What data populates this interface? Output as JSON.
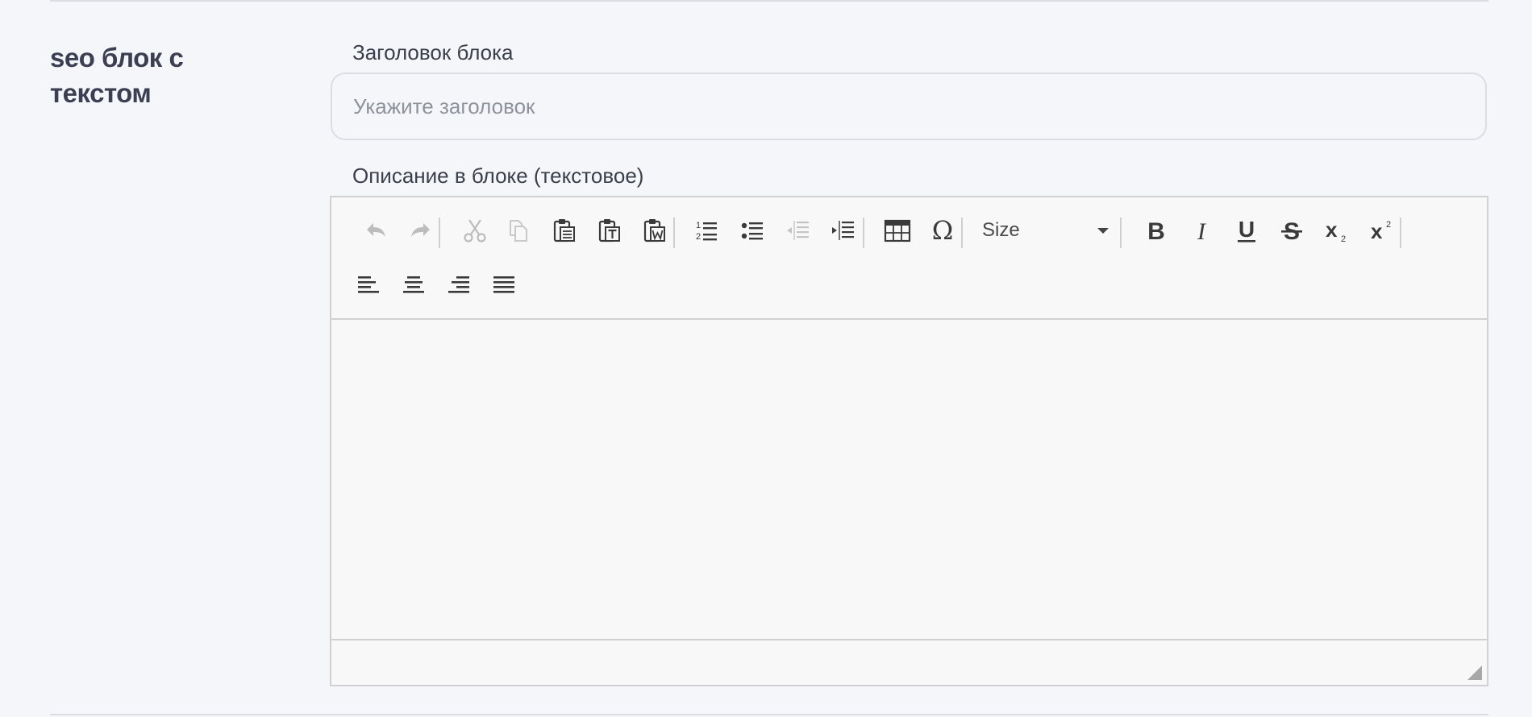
{
  "section": {
    "title": "seo блок с текстом"
  },
  "title_field": {
    "label": "Заголовок блока",
    "placeholder": "Укажите заголовок",
    "value": ""
  },
  "description_field": {
    "label": "Описание в блоке (текстовое)",
    "value": ""
  },
  "toolbar": {
    "size_label": "Size",
    "buttons": [
      "Undo",
      "Redo",
      "Cut",
      "Copy",
      "Paste",
      "Paste as plain text",
      "Paste from Word",
      "Insert/Remove Numbered List",
      "Insert/Remove Bulleted List",
      "Decrease Indent",
      "Increase Indent",
      "Table",
      "Insert Special Character",
      "Bold",
      "Italic",
      "Underline",
      "Strikethrough",
      "Subscript",
      "Superscript",
      "Align Left",
      "Center",
      "Align Right",
      "Justify"
    ]
  }
}
